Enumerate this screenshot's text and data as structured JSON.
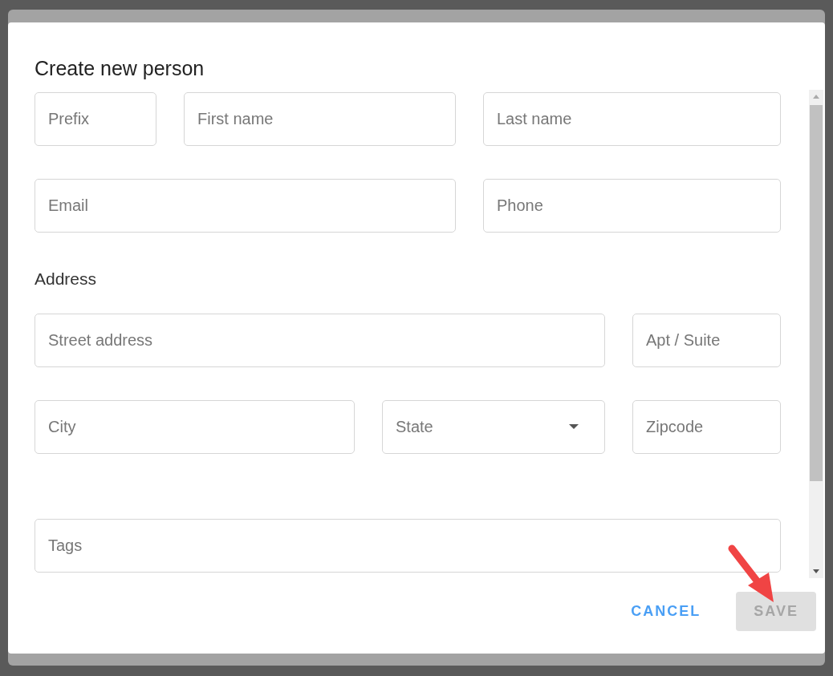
{
  "dialog": {
    "title": "Create new person",
    "sections": [
      {
        "fields": [
          {
            "kind": "input",
            "placeholder": "Prefix"
          },
          {
            "kind": "input",
            "placeholder": "First name"
          },
          {
            "kind": "input",
            "placeholder": "Last name"
          },
          {
            "kind": "input",
            "placeholder": "Email"
          },
          {
            "kind": "input",
            "placeholder": "Phone"
          }
        ]
      },
      {
        "heading": "Address",
        "fields": [
          {
            "kind": "input",
            "placeholder": "Street address"
          },
          {
            "kind": "input",
            "placeholder": "Apt / Suite"
          },
          {
            "kind": "input",
            "placeholder": "City"
          },
          {
            "kind": "select",
            "placeholder": "State"
          },
          {
            "kind": "input",
            "placeholder": "Zipcode"
          }
        ]
      },
      {
        "fields": [
          {
            "kind": "input",
            "placeholder": "Tags"
          }
        ]
      }
    ],
    "buttons": [
      {
        "label": "CANCEL",
        "kind": "text",
        "disabled": false
      },
      {
        "label": "SAVE",
        "kind": "contained",
        "disabled": true
      }
    ]
  }
}
